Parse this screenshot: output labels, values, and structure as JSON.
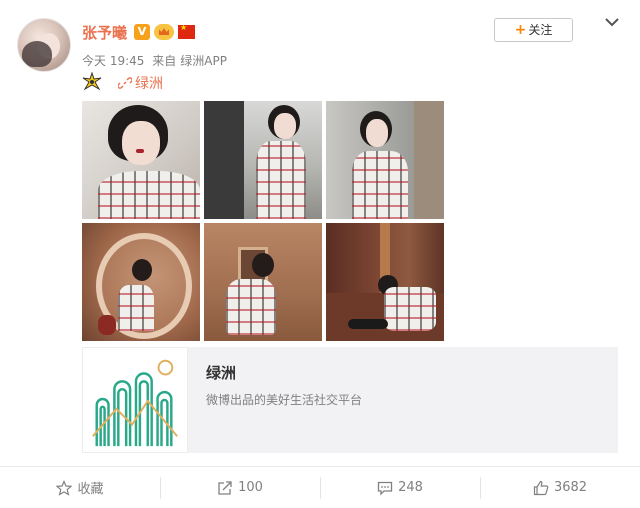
{
  "post": {
    "username": "张予曦",
    "badge_v": "V",
    "time": "今天 19:45",
    "source_prefix": "来自",
    "source": "绿洲APP",
    "follow_label": "关注",
    "location": "绿洲"
  },
  "link_card": {
    "title": "绿洲",
    "description": "微博出品的美好生活社交平台"
  },
  "actions": {
    "favorite_label": "收藏",
    "repost_count": "100",
    "comment_count": "248",
    "like_count": "3682"
  },
  "colors": {
    "accent": "#eb7350",
    "follow_plus": "#ff8200",
    "muted_text": "#808080",
    "card_bg": "#f2f2f5"
  },
  "icons": {
    "chevron": "chevron-down-icon",
    "emoji": "sparkle-emoji-icon",
    "location": "link-icon",
    "favorite": "star-icon",
    "repost": "share-icon",
    "comment": "comment-icon",
    "like": "thumbs-up-icon"
  }
}
